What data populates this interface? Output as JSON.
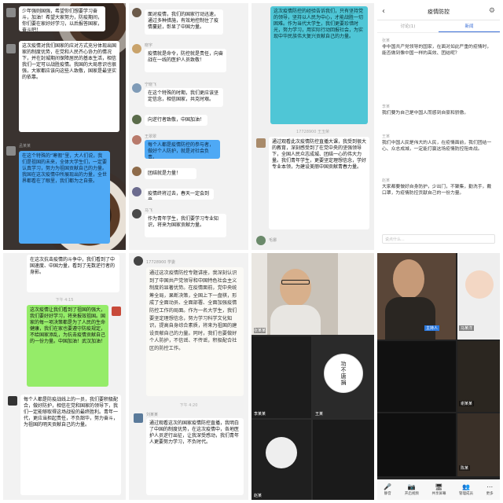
{
  "panel1": {
    "bubble_top": "少年强则国强，希望你们想要学习奋斗，加油！希望大家努力，防疫期间，你们要在家好好学习，以后报答国家，奋斗吧！",
    "bubble_mid": "这次疫情对我们国家的应对方式充分体现出国家的制度优势，在党和人民齐心协力的情况下，并在封城期间保障居民的基本生活，相信我们一定可以战胜疫情。我国的大局意识也很强，大家都应该向这些人致敬，国家是最坚实的依靠。",
    "uname": "孟某某",
    "bubble_blue": "在这个特殊的“寒假”里，大人们说，我们是祖国的未来，全体大学生们，一定要认真学习，努力为祖国贡献自己的力量。我国在这次疫情中所展现出的力量，全世界都看在了眼里，我们都为之自豪。"
  },
  "panel2": {
    "msg1": "面对疫情，我们的国家行动迅速，通过多种措施，有效地控制住了疫情蔓延，彰显了中国力量。",
    "uname2": "晓宇",
    "msg2": "疫情就是命令，防控就是责任，向奋战在一线的医护人员致敬！",
    "uname3": "宁晓飞",
    "msg3": "在这个特殊的时期，我们更应该坚定信念，相信国家，共克时艰。",
    "msg4": "向逆行者致敬，中国加油！",
    "uname5": "王翠翠",
    "msg5": "每个人都是疫情防控的参与者，做好个人防护，就是对社会负责。",
    "msg6": "团结就是力量！",
    "msg7": "疫情终将过去，春天一定会到来。",
    "uname8": "马飞",
    "msg8": "作为青年学生，我们要学习专业知识，将来为国家贡献力量。"
  },
  "panel3": {
    "msg_top": "这次疫情防控的经验告诉我们，只有坚持党的领导，坚持以人民为中心，才能战胜一切困难。作为当代大学生，我们更要珍惜时光，努力学习，用实际行动回报社会，为实现中华民族伟大复兴贡献自己的力量。",
    "timestamp": "17728900 王玉荣",
    "msg_bottom": "通过观看此次疫情防控直播大课，我受到很大的教育，深刻感受到了在党中央的坚强领导下，全国人民众志成城、团结一心的伟大力量。我们青年学生，更要坚定理想信念，学好专业本领，为建设美丽中国贡献青春力量。",
    "uname": "毛娜"
  },
  "panel4": {
    "title": "疫情防控",
    "tab_a": "讨论(1)",
    "tab_b": "新闻",
    "msg1": "非中国共产党领导的国家，在面对如此严重的疫情时，能否做到像中国一样的高效、团结呢？",
    "msg2": "我们要为自己是中国人而感到自豪和骄傲。",
    "msg3": "我们中国人民是伟大的人民，在疫情面前，我们团结一心、众志成城，一定能打赢这场疫情防控阻击战。",
    "msg4": "大家都要做好自身防护，少出门，不聚集，勤洗手，戴口罩，为疫情防控贡献自己的一份力量。",
    "input_placeholder": "说点什么...",
    "names": [
      "张某",
      "李某",
      "王某",
      "赵某"
    ]
  },
  "panel5": {
    "msg_top": "在这次抗击疫情的斗争中，我们看到了中国速度、中国力量，看到了无数逆行者的身影。",
    "timestamp": "下午 4:15",
    "msg_green": "这次疫情让我们看到了祖国的强大，我们要好好学习，将来报效祖国。国家的每一项决策都是为了人民的生命健康，我们在家也要遵守防疫规定，不给国家添乱，为抗击疫情贡献自己的一份力量。中国加油！武汉加油！",
    "msg_bottom": "每个人都是防疫战线上的一员，我们要积极配合，做好防护，相信在党和国家的领导下，我们一定能够取得这场战役的最终胜利。青年一代，更应当担起责任，不负韶华，努力奋斗，为祖国的明天贡献自己的力量。"
  },
  "panel6": {
    "header": "17728900 学委",
    "paper_text": "通过这次疫情防控专题讲座，我深刻认识到了中国共产党领导和中国特色社会主义制度的显著优势。在疫情面前，党中央统筹全局，果断决策，全国上下一盘棋，形成了全面动员、全面部署、全面加强疫情防控工作的局面。作为一名大学生，我们要坚定理想信念，努力学习科学文化知识，提高自身综合素质，将来为祖国的建设贡献自己的力量。同时，我们也要做好个人防护，不信谣、不传谣，积极配合社区的防控工作。",
    "timestamp": "下午 4:20",
    "uname": "刘某某",
    "msg_bottom": "通过观看这次的国家疫情防控直播，我明白了中国的制度优势，在这次疫情中，各地医护人员逆行出征，让我深受感动，我们青年人更要努力学习，不负时代。"
  },
  "panel7": {
    "seal_text": "功不唐捐",
    "label1": "张某某",
    "label2": "李某某",
    "label3": "王某",
    "label4": "赵某"
  },
  "panel8": {
    "badge_self": "主持人",
    "name1": "马某洋",
    "name2": "谢某某",
    "name3": "陈某",
    "tools": [
      {
        "icon": "🎤",
        "label": "静音"
      },
      {
        "icon": "📷",
        "label": "开启视频"
      },
      {
        "icon": "🖥",
        "label": "共享屏幕"
      },
      {
        "icon": "👥",
        "label": "管理成员"
      },
      {
        "icon": "⋯",
        "label": "更多"
      }
    ]
  }
}
